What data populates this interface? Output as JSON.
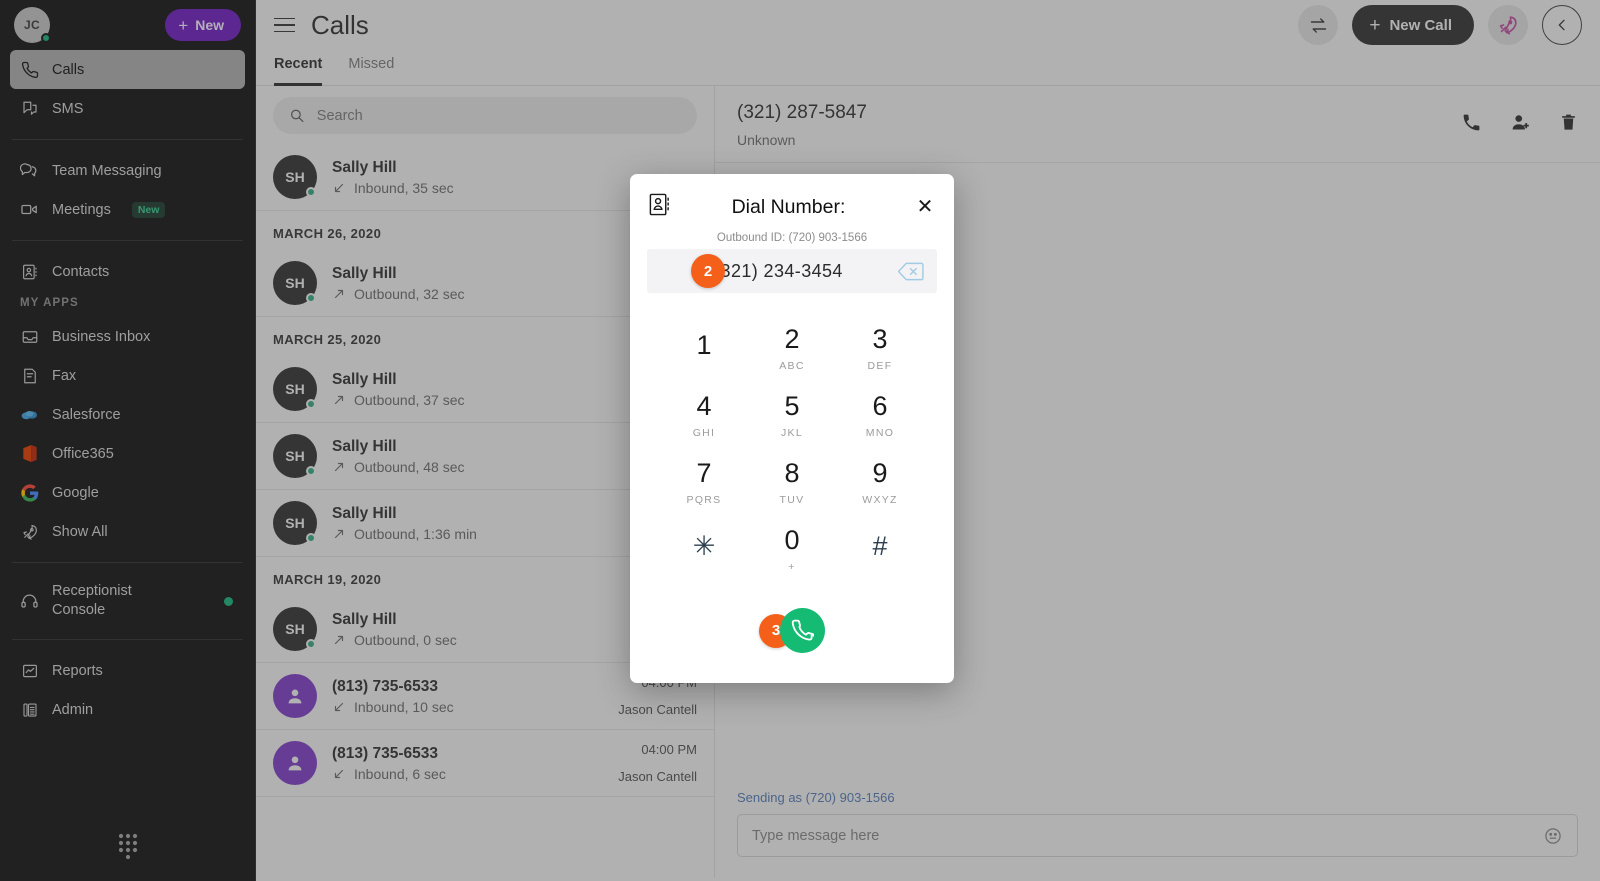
{
  "sidebar": {
    "user": {
      "initials": "JC",
      "presence": "online"
    },
    "new_button": {
      "label": "New",
      "icon": "plus-icon",
      "color": "#6a1fb5"
    },
    "primary_items": [
      {
        "label": "Calls",
        "icon": "phone-icon",
        "active": true
      },
      {
        "label": "SMS",
        "icon": "sms-icon",
        "active": false
      }
    ],
    "secondary_items": [
      {
        "label": "Team Messaging",
        "icon": "chat-bubbles-icon"
      },
      {
        "label": "Meetings",
        "icon": "video-camera-icon",
        "badge": "New"
      }
    ],
    "contacts_item": {
      "label": "Contacts",
      "icon": "contact-card-icon"
    },
    "my_apps_label": "MY APPS",
    "apps": [
      {
        "label": "Business Inbox",
        "icon": "inbox-icon"
      },
      {
        "label": "Fax",
        "icon": "fax-icon"
      },
      {
        "label": "Salesforce",
        "icon": "salesforce-cloud-icon"
      },
      {
        "label": "Office365",
        "icon": "office365-icon"
      },
      {
        "label": "Google",
        "icon": "google-g-icon"
      },
      {
        "label": "Show All",
        "icon": "rocket-icon"
      }
    ],
    "receptionist": {
      "label": "Receptionist Console",
      "line1": "Receptionist",
      "line2": "Console",
      "icon": "headset-icon",
      "status_dot": "#19a974"
    },
    "bottom_items": [
      {
        "label": "Reports",
        "icon": "chart-icon"
      },
      {
        "label": "Admin",
        "icon": "desk-phone-icon"
      }
    ],
    "dialpad_icon": "dialpad-icon"
  },
  "header": {
    "menu_icon": "hamburger-icon",
    "title": "Calls",
    "transfer_icon": "call-transfer-icon",
    "new_call": {
      "label": "New Call",
      "icon": "plus-icon"
    },
    "rocket_icon": "rocket-icon",
    "collapse_icon": "chevron-left-icon"
  },
  "tabs": [
    {
      "label": "Recent",
      "active": true
    },
    {
      "label": "Missed",
      "active": false
    }
  ],
  "search": {
    "placeholder": "Search",
    "value": "",
    "icon": "search-icon"
  },
  "call_list": [
    {
      "type": "entry",
      "name": "Sally Hill",
      "initials": "SH",
      "avatar_color": "#161616",
      "direction": "Inbound",
      "detail": "Inbound, 35 sec",
      "time": "",
      "owner": "",
      "presence": true
    },
    {
      "type": "date",
      "label": "MARCH 26, 2020"
    },
    {
      "type": "entry",
      "name": "Sally Hill",
      "initials": "SH",
      "avatar_color": "#161616",
      "direction": "Outbound",
      "detail": "Outbound, 32 sec",
      "time": "",
      "owner": "",
      "presence": true
    },
    {
      "type": "date",
      "label": "MARCH 25, 2020"
    },
    {
      "type": "entry",
      "name": "Sally Hill",
      "initials": "SH",
      "avatar_color": "#161616",
      "direction": "Outbound",
      "detail": "Outbound, 37 sec",
      "time": "",
      "owner": "",
      "presence": true
    },
    {
      "type": "entry",
      "name": "Sally Hill",
      "initials": "SH",
      "avatar_color": "#161616",
      "direction": "Outbound",
      "detail": "Outbound, 48 sec",
      "time": "",
      "owner": "",
      "presence": true
    },
    {
      "type": "entry",
      "name": "Sally Hill",
      "initials": "SH",
      "avatar_color": "#161616",
      "direction": "Outbound",
      "detail": "Outbound, 1:36 min",
      "time": "",
      "owner": "",
      "presence": true
    },
    {
      "type": "date",
      "label": "MARCH 19, 2020"
    },
    {
      "type": "entry",
      "name": "Sally Hill",
      "initials": "SH",
      "avatar_color": "#161616",
      "direction": "Outbound",
      "detail": "Outbound, 0 sec",
      "time": "",
      "owner": "",
      "presence": true
    },
    {
      "type": "entry",
      "name": "(813) 735-6533",
      "initials": "",
      "avatar_color": "#7322c9",
      "direction": "Inbound",
      "detail": "Inbound, 10 sec",
      "time": "04:00 PM",
      "owner": "Jason Cantell",
      "presence": false
    },
    {
      "type": "entry",
      "name": "(813) 735-6533",
      "initials": "",
      "avatar_color": "#7322c9",
      "direction": "Inbound",
      "detail": "Inbound, 6 sec",
      "time": "04:00 PM",
      "owner": "Jason Cantell",
      "presence": false
    }
  ],
  "detail": {
    "number": "(321) 287-5847",
    "subtitle": "Unknown",
    "actions": [
      {
        "name": "call-icon"
      },
      {
        "name": "add-contact-icon"
      },
      {
        "name": "trash-icon"
      }
    ],
    "sending_as": "Sending as (720) 903-1566",
    "message_placeholder": "Type message here",
    "message_value": "",
    "emoji_icon": "emoji-icon"
  },
  "modal": {
    "contacts_icon": "address-book-icon",
    "title": "Dial Number:",
    "close_icon": "close-icon",
    "outbound_id": "Outbound ID: (720) 903-1566",
    "dialed_number": "(321) 234-3454",
    "backspace_icon": "backspace-icon",
    "step_badge_input": "2",
    "step_badge_call": "3",
    "call_button_icon": "phone-icon",
    "call_button_color": "#15bb72",
    "badge_color": "#f4601a",
    "keys": [
      {
        "digit": "1",
        "letters": ""
      },
      {
        "digit": "2",
        "letters": "ABC"
      },
      {
        "digit": "3",
        "letters": "DEF"
      },
      {
        "digit": "4",
        "letters": "GHI"
      },
      {
        "digit": "5",
        "letters": "JKL"
      },
      {
        "digit": "6",
        "letters": "MNO"
      },
      {
        "digit": "7",
        "letters": "PQRS"
      },
      {
        "digit": "8",
        "letters": "TUV"
      },
      {
        "digit": "9",
        "letters": "WXYZ"
      },
      {
        "digit": "✳",
        "letters": "",
        "symbol": true
      },
      {
        "digit": "0",
        "letters": "+"
      },
      {
        "digit": "#",
        "letters": "",
        "symbol": true
      }
    ]
  }
}
